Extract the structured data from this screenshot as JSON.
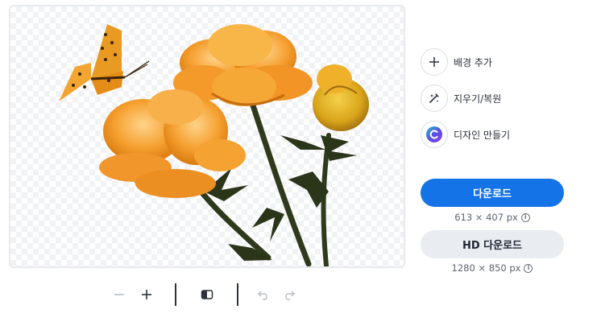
{
  "actions": [
    {
      "label": "배경 추가",
      "icon": "plus-icon"
    },
    {
      "label": "지우기/복원",
      "icon": "magic-brush-icon"
    },
    {
      "label": "디자인 만들기",
      "icon": "canva-logo-icon"
    }
  ],
  "download": {
    "label": "다운로드",
    "size": "613 × 407 px"
  },
  "hd_download": {
    "label": "HD 다운로드",
    "size": "1280 × 850 px"
  },
  "toolbar": {
    "icons": [
      "zoom-out-icon",
      "zoom-in-icon",
      "compare-icon",
      "undo-icon",
      "redo-icon"
    ]
  },
  "colors": {
    "primary": "#1473e6",
    "secondary": "#e9ecf0",
    "flower": "#f4a531",
    "stem": "#2f3a1c"
  },
  "info_glyph": "i"
}
